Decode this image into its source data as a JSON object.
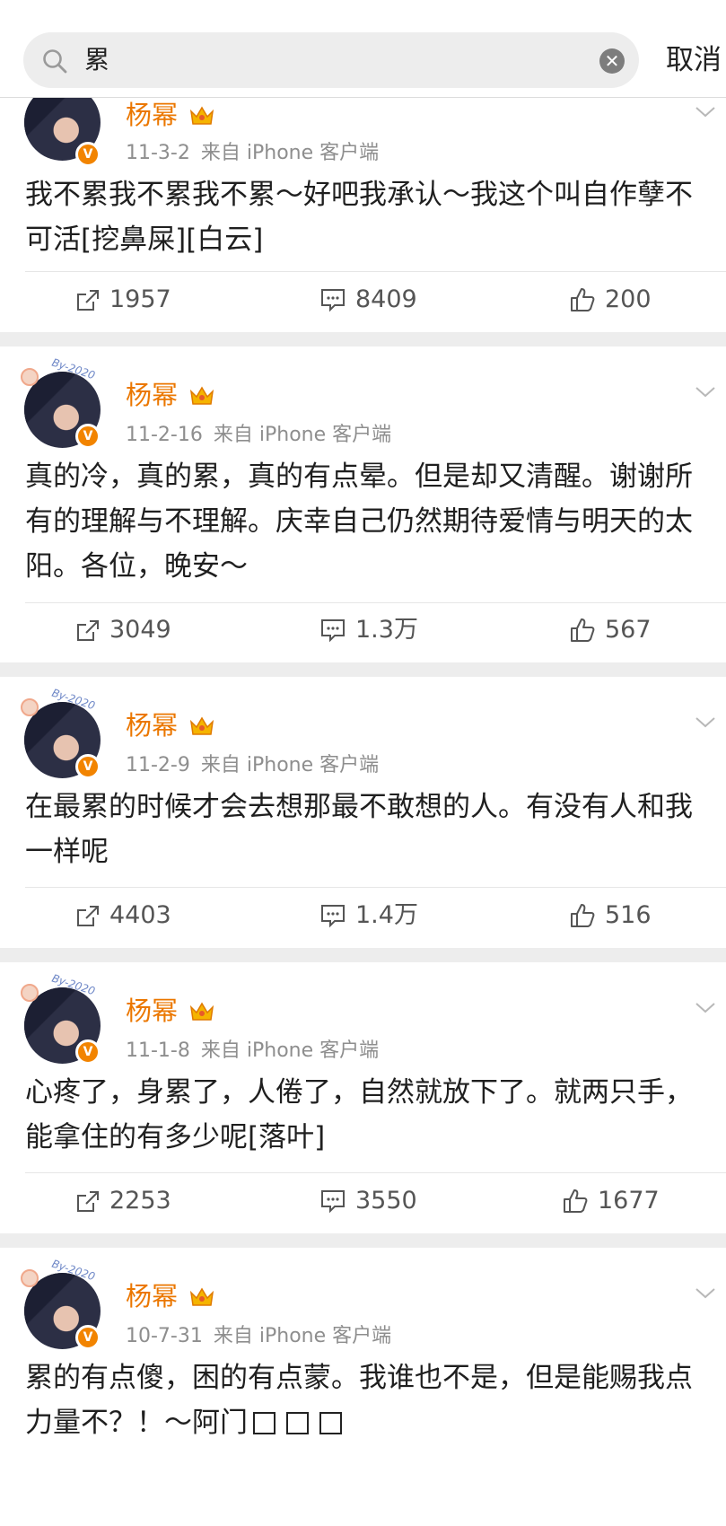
{
  "search": {
    "query": "累",
    "cancel_label": "取消"
  },
  "posts": [
    {
      "username": "杨幂",
      "date": "11-3-2",
      "source": "来自 iPhone 客户端",
      "text": "我不累我不累我不累～好吧我承认～我这个叫自作孽不可活[挖鼻屎][白云]",
      "reposts": "1957",
      "comments": "8409",
      "likes": "200"
    },
    {
      "username": "杨幂",
      "date": "11-2-16",
      "source": "来自 iPhone 客户端",
      "text": "真的冷，真的累，真的有点晕。但是却又清醒。谢谢所有的理解与不理解。庆幸自己仍然期待爱情与明天的太阳。各位，晚安～",
      "reposts": "3049",
      "comments": "1.3万",
      "likes": "567"
    },
    {
      "username": "杨幂",
      "date": "11-2-9",
      "source": "来自 iPhone 客户端",
      "text": "在最累的时候才会去想那最不敢想的人。有没有人和我一样呢",
      "reposts": "4403",
      "comments": "1.4万",
      "likes": "516"
    },
    {
      "username": "杨幂",
      "date": "11-1-8",
      "source": "来自 iPhone 客户端",
      "text": "心疼了，身累了，人倦了，自然就放下了。就两只手，能拿住的有多少呢[落叶]",
      "reposts": "2253",
      "comments": "3550",
      "likes": "1677"
    },
    {
      "username": "杨幂",
      "date": "10-7-31",
      "source": "来自 iPhone 客户端",
      "text": "累的有点傻，困的有点蒙。我谁也不是，但是能赐我点力量不？！～阿门"
    }
  ],
  "colors": {
    "username": "#eb7700",
    "verified": "#f28400",
    "page_bg": "#ededed"
  },
  "icons": [
    "search-icon",
    "clear-icon",
    "vip-crown-icon",
    "verified-badge-icon",
    "chevron-down-icon",
    "repost-icon",
    "comment-icon",
    "like-icon"
  ]
}
